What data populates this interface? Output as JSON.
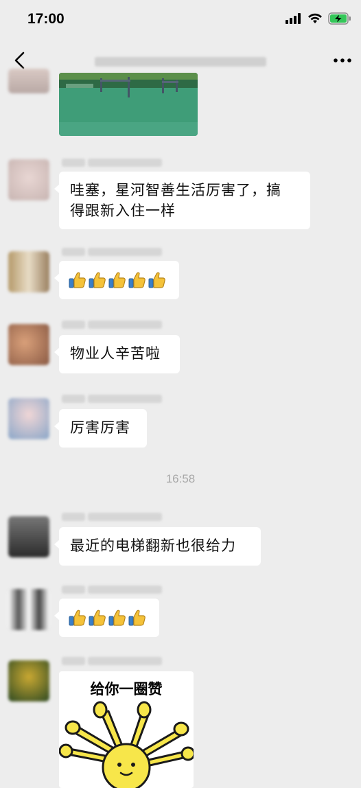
{
  "status": {
    "time": "17:00"
  },
  "header": {
    "back_icon": "chevron-left-icon",
    "more_icon": "ellipsis-icon"
  },
  "messages": [
    {
      "id": "m1",
      "text": "哇塞，星河智善生活厉害了，搞得跟新入住一样",
      "line1": "哇塞，星河智善生活厉害了，搞",
      "line2": "得跟新入住一样"
    },
    {
      "id": "m2",
      "thumbs_count": 5
    },
    {
      "id": "m3",
      "text": "物业人辛苦啦"
    },
    {
      "id": "m4",
      "text": "厉害厉害"
    },
    {
      "id": "m5",
      "text": "最近的电梯翻新也很给力"
    },
    {
      "id": "m6",
      "thumbs_count": 4
    },
    {
      "id": "m7",
      "sticker_text": "给你一圈赞"
    }
  ],
  "timestamp": "16:58",
  "colors": {
    "background": "#ededed",
    "bubble": "#ffffff",
    "timestamp": "#a8a8a8"
  }
}
